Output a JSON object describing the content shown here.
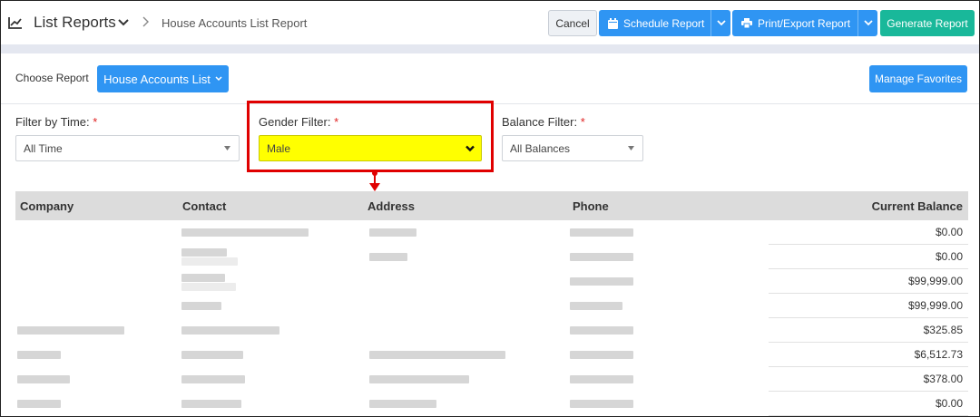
{
  "header": {
    "title": "List Reports",
    "breadcrumb": "House Accounts List Report",
    "buttons": {
      "cancel": "Cancel",
      "schedule": "Schedule Report",
      "print_export": "Print/Export Report",
      "generate": "Generate Report"
    }
  },
  "choose": {
    "label": "Choose Report",
    "selected_report": "House Accounts List",
    "manage_favorites": "Manage Favorites"
  },
  "filters": {
    "time": {
      "label": "Filter by Time:",
      "required": "*",
      "value": "All Time"
    },
    "gender": {
      "label": "Gender Filter:",
      "required": "*",
      "value": "Male"
    },
    "balance": {
      "label": "Balance Filter:",
      "required": "*",
      "value": "All Balances"
    }
  },
  "table": {
    "columns": [
      "Company",
      "Contact",
      "Address",
      "Phone",
      "Current Balance"
    ],
    "balances": [
      "$0.00",
      "$0.00",
      "$99,999.00",
      "$99,999.00",
      "$325.85",
      "$6,512.73",
      "$378.00",
      "$0.00"
    ]
  },
  "icons": {
    "app": "line-chart-icon",
    "calendar": "calendar-icon",
    "print": "printer-icon"
  },
  "colors": {
    "primary": "#2f95f3",
    "success": "#19b89a",
    "highlight": "#ffff00",
    "annotation": "#e00000"
  }
}
